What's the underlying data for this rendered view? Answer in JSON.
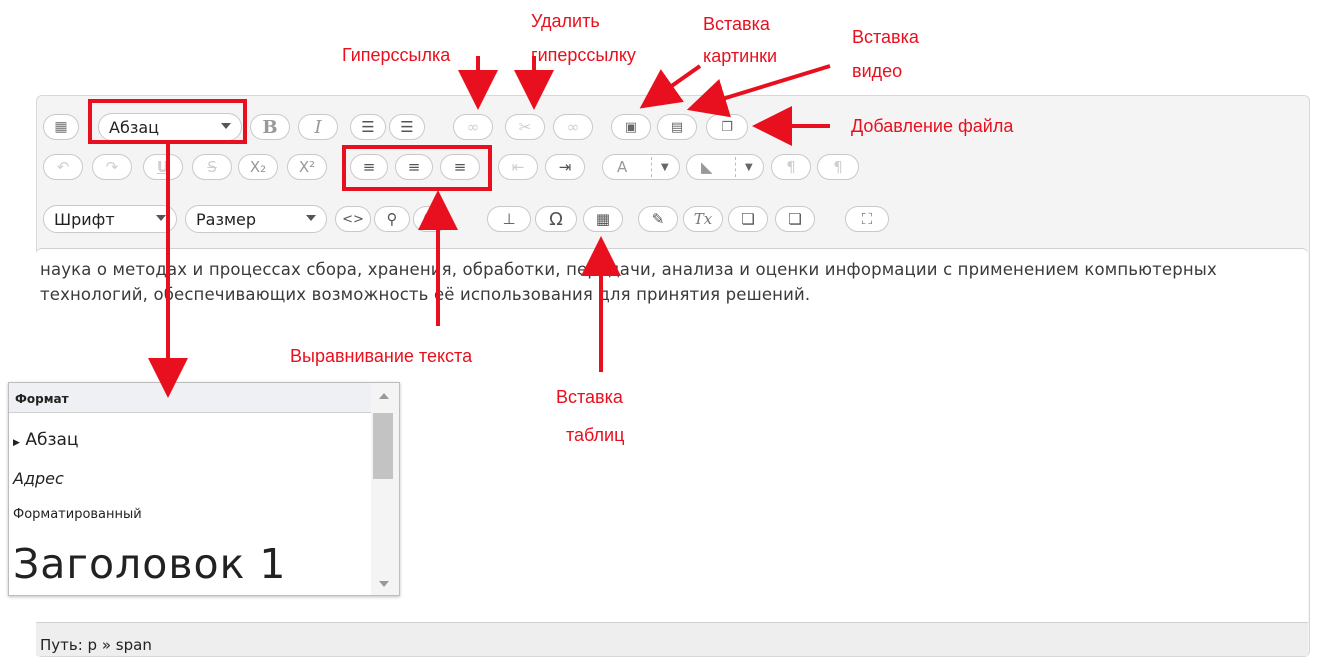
{
  "toolbar": {
    "paragraph_dropdown": "Абзац",
    "font_dropdown": "Шрифт",
    "size_dropdown": "Размер",
    "bold": "B",
    "italic": "I",
    "subscript": "X₂",
    "superscript": "X²",
    "special_char": "Ω",
    "clear_format": "Tx"
  },
  "content": {
    "text": "наука о методах и процессах сбора, хранения, обработки, передачи, анализа и оценки информации с применением компьютерных технологий, обеспечивающих возможность её использования для принятия решений."
  },
  "statusbar": {
    "path": "Путь: p » span"
  },
  "format_popup": {
    "header": "Формат",
    "items": [
      "Абзац",
      "Адрес",
      "Форматированный",
      "Заголовок 1"
    ]
  },
  "annotations": {
    "hyperlink": "Гиперссылка",
    "remove_hyperlink_1": "Удалить",
    "remove_hyperlink_2": "гиперссылку",
    "insert_image_1": "Вставка",
    "insert_image_2": "картинки",
    "insert_video_1": "Вставка",
    "insert_video_2": "видео",
    "add_file": "Добавление файла",
    "text_align": "Выравнивание текста",
    "insert_table_1": "Вставка",
    "insert_table_2": "таблиц"
  },
  "colors": {
    "annotation_red": "#e8101e",
    "toolbar_bg": "#f4f4f4"
  },
  "icons": [
    "keyboard-icon",
    "bullet-list-icon",
    "numbered-list-icon",
    "link-icon",
    "unlink-icon",
    "anchor-icon",
    "image-icon",
    "video-icon",
    "file-icon",
    "undo-icon",
    "redo-icon",
    "underline-icon",
    "strikethrough-icon",
    "align-left-icon",
    "align-center-icon",
    "align-right-icon",
    "outdent-icon",
    "indent-icon",
    "text-color-icon",
    "background-color-icon",
    "ltr-icon",
    "rtl-icon",
    "html-icon",
    "find-icon",
    "replace-icon",
    "insert-time-icon",
    "special-char-icon",
    "table-icon",
    "clean-icon",
    "clear-format-icon",
    "paste-text-icon",
    "paste-word-icon",
    "fullscreen-icon"
  ]
}
